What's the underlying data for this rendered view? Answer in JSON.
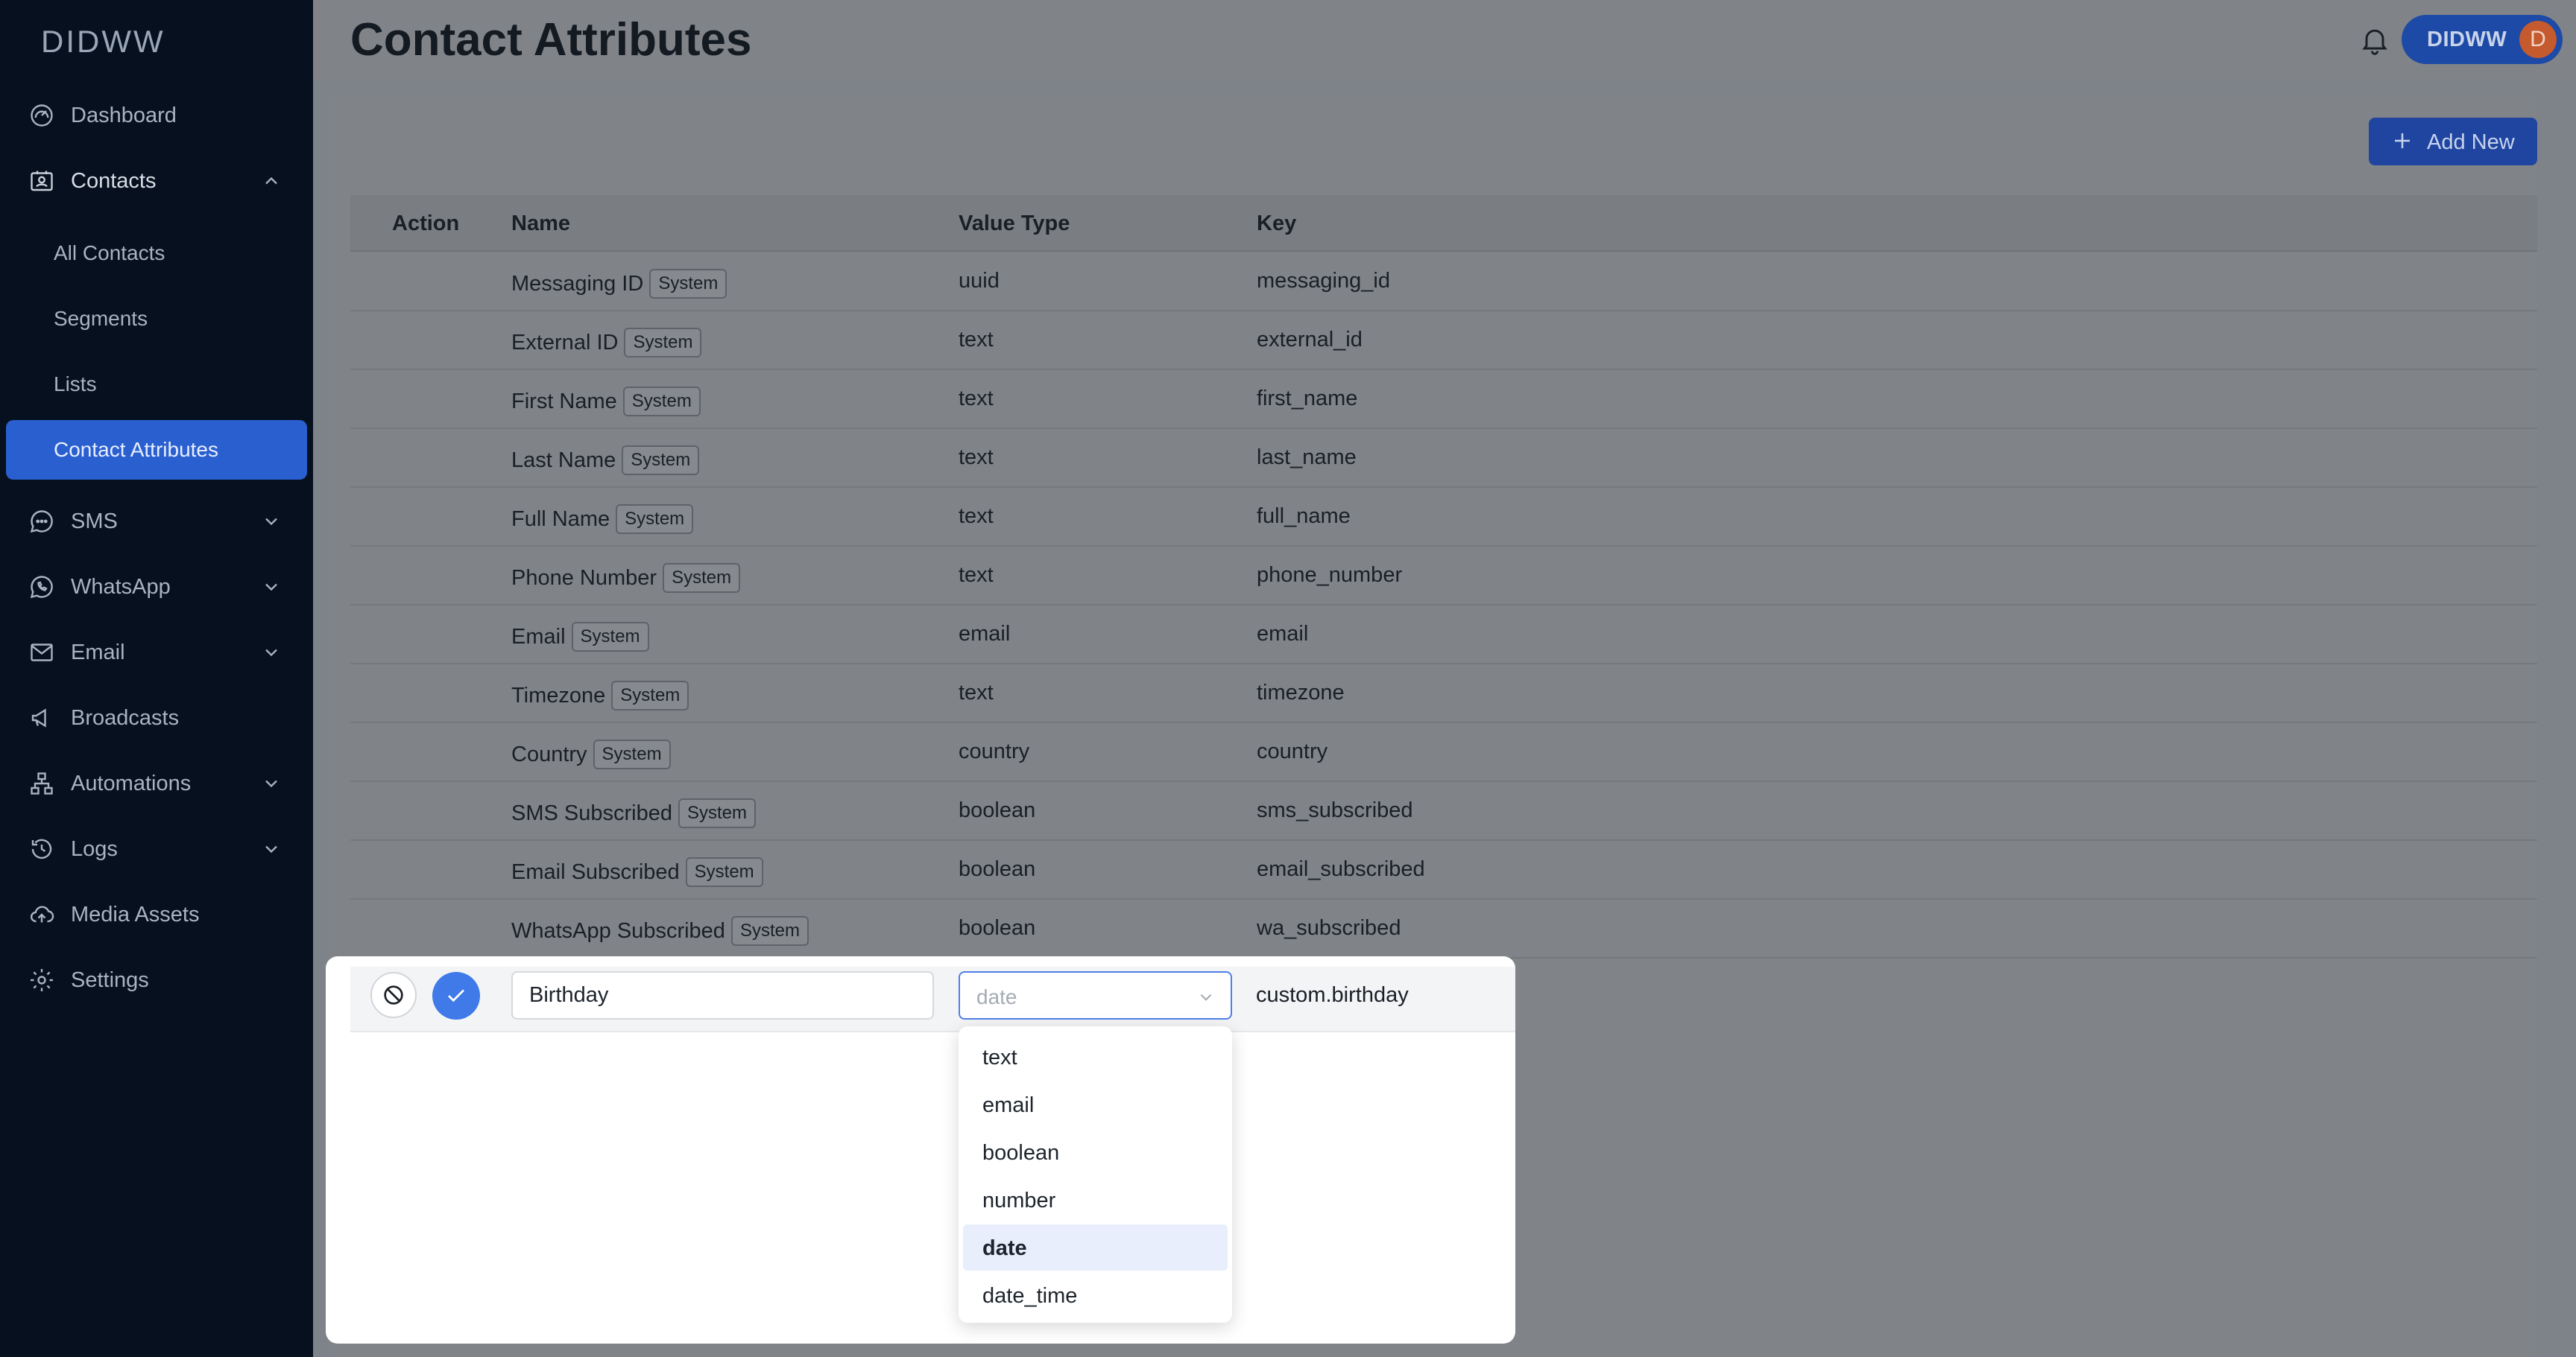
{
  "app": {
    "logo": "DIDWW"
  },
  "sidebar": {
    "items": [
      {
        "label": "Dashboard",
        "icon": "gauge-icon"
      },
      {
        "label": "Contacts",
        "icon": "contacts-icon",
        "expanded": true
      },
      {
        "label": "SMS",
        "icon": "chat-bubble-icon"
      },
      {
        "label": "WhatsApp",
        "icon": "whatsapp-icon"
      },
      {
        "label": "Email",
        "icon": "envelope-icon"
      },
      {
        "label": "Broadcasts",
        "icon": "megaphone-icon"
      },
      {
        "label": "Automations",
        "icon": "flow-icon"
      },
      {
        "label": "Logs",
        "icon": "history-icon"
      },
      {
        "label": "Media Assets",
        "icon": "cloud-upload-icon"
      },
      {
        "label": "Settings",
        "icon": "gear-icon"
      }
    ],
    "contacts_sub": [
      "All Contacts",
      "Segments",
      "Lists",
      "Contact Attributes"
    ],
    "active_sub": "Contact Attributes"
  },
  "header": {
    "title": "Contact Attributes",
    "user_name": "DIDWW",
    "user_initial": "D"
  },
  "toolbar": {
    "add_label": "Add New"
  },
  "table": {
    "columns": [
      "Action",
      "Name",
      "Value Type",
      "Key"
    ],
    "badge_label": "System",
    "rows": [
      {
        "name": "Messaging ID",
        "type": "uuid",
        "key": "messaging_id"
      },
      {
        "name": "External ID",
        "type": "text",
        "key": "external_id"
      },
      {
        "name": "First Name",
        "type": "text",
        "key": "first_name"
      },
      {
        "name": "Last Name",
        "type": "text",
        "key": "last_name"
      },
      {
        "name": "Full Name",
        "type": "text",
        "key": "full_name"
      },
      {
        "name": "Phone Number",
        "type": "text",
        "key": "phone_number"
      },
      {
        "name": "Email",
        "type": "email",
        "key": "email"
      },
      {
        "name": "Timezone",
        "type": "text",
        "key": "timezone"
      },
      {
        "name": "Country",
        "type": "country",
        "key": "country"
      },
      {
        "name": "SMS Subscribed",
        "type": "boolean",
        "key": "sms_subscribed"
      },
      {
        "name": "Email Subscribed",
        "type": "boolean",
        "key": "email_subscribed"
      },
      {
        "name": "WhatsApp Subscribed",
        "type": "boolean",
        "key": "wa_subscribed"
      }
    ]
  },
  "edit_row": {
    "name_value": "Birthday",
    "type_value": "date",
    "key_value": "custom.birthday"
  },
  "dropdown": {
    "options": [
      "text",
      "email",
      "boolean",
      "number",
      "date",
      "date_time"
    ],
    "selected": "date"
  },
  "colors": {
    "sidebar_bg": "#06101e",
    "accent": "#2a5fd0",
    "confirm": "#3f7ae8"
  }
}
